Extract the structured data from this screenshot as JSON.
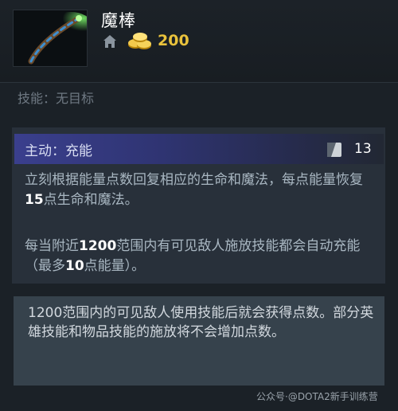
{
  "item": {
    "name": "魔棒",
    "icon": "magic-stick-icon",
    "cost": "200"
  },
  "skill_target": "技能：无目标",
  "active": {
    "label": "主动：充能",
    "charges": "13",
    "desc1": {
      "pre": "立刻根据能量点数回复相应的生命和魔法，每点能量恢复",
      "num": "15",
      "post": "点生命和魔法。"
    },
    "desc2": {
      "pre": "每当附近",
      "num1": "1200",
      "mid": "范围内有可见敌人施放技能都会自动充能（最多",
      "num2": "10",
      "post": "点能量）。"
    }
  },
  "note": "1200范围内的可见敌人使用技能后就会获得点数。部分英雄技能和物品技能的施放将不会增加点数。",
  "watermark": "公众号·@DOTA2新手训练营",
  "colors": {
    "background": "#1b2127",
    "gold": "#e9c23c",
    "active_bar": "#3a3f8d",
    "panel": "#28303a",
    "note_panel": "#36424c"
  }
}
